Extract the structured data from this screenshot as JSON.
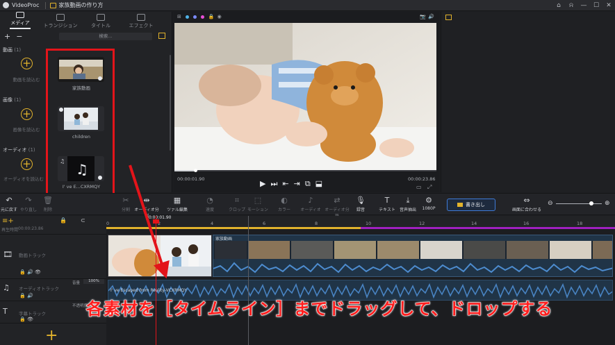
{
  "app": {
    "name": "VideoProc",
    "project_title": "家族動画の作り方"
  },
  "window_controls": [
    "⌂",
    "⍾",
    "—",
    "☐",
    "✕"
  ],
  "left_panel": {
    "tabs": [
      {
        "label": "メディア",
        "active": true
      },
      {
        "label": "トランジション",
        "active": false
      },
      {
        "label": "タイトル",
        "active": false
      },
      {
        "label": "エフェクト",
        "active": false
      }
    ],
    "add_symbol": "+",
    "remove_symbol": "−",
    "search_placeholder": "検索...",
    "sections": [
      {
        "title": "動画",
        "count": "(1)",
        "add_label": "動画を読込む",
        "item_label": "家族動画"
      },
      {
        "title": "画像",
        "count": "(1)",
        "add_label": "画像を読込む",
        "item_label": "children"
      },
      {
        "title": "オーディオ",
        "count": "(1)",
        "add_label": "オーディオを読込む",
        "item_label": "I' ve E...CXRMQY"
      }
    ]
  },
  "preview": {
    "current_time": "00:00:01.90",
    "total_time": "00:00:23.86",
    "toolbar_icons": [
      "grid-icon",
      "color-dots",
      "lock-icon",
      "eye-icon",
      "camera-icon",
      "volume-icon"
    ]
  },
  "edit_toolbar": {
    "tools": [
      {
        "label": "元に戻す",
        "icon": "↶",
        "enabled": true
      },
      {
        "label": "やり直し",
        "icon": "↷",
        "enabled": false
      },
      {
        "label": "削除",
        "icon": "🗑",
        "enabled": false
      },
      {
        "label": "分割",
        "icon": "✂",
        "enabled": false
      },
      {
        "label": "オーディオ分割",
        "icon": "⇹",
        "enabled": true
      },
      {
        "label": "ツァル編集",
        "icon": "▦",
        "enabled": true
      },
      {
        "label": "速度",
        "icon": "◔",
        "enabled": false
      },
      {
        "label": "クロップ",
        "icon": "⌗",
        "enabled": false
      },
      {
        "label": "モーション",
        "icon": "⬚",
        "enabled": false
      },
      {
        "label": "カラー",
        "icon": "◐",
        "enabled": false
      },
      {
        "label": "オーディオ",
        "icon": "♪",
        "enabled": false
      },
      {
        "label": "オーディオ分離",
        "icon": "⇄",
        "enabled": false
      },
      {
        "label": "録音",
        "icon": "🎙",
        "enabled": true
      },
      {
        "label": "テキスト",
        "icon": "T",
        "enabled": true
      },
      {
        "label": "音声抽出",
        "icon": "⤓",
        "enabled": true
      },
      {
        "label": "1080P",
        "icon": "⚙",
        "enabled": true
      }
    ],
    "export_label": "書き出し",
    "fit_label": "画面に合わせる",
    "zoom_minus": "⊖",
    "zoom_plus": "⊕",
    "zoom_level": 0.78
  },
  "timeline": {
    "head_label": "再生時間",
    "timecode": "00:00:23.86",
    "playhead_time": "00:00:01.90",
    "ruler_marks": [
      "0",
      "2",
      "4",
      "6",
      "8",
      "10",
      "12",
      "14",
      "16",
      "18"
    ],
    "tracks": [
      {
        "name": "動画トラック",
        "icon": "🎞"
      },
      {
        "name": "オーディオトラック",
        "icon": "♫",
        "volume_label": "音量",
        "volume": "100%"
      },
      {
        "name": "字幕トラック",
        "icon": "T",
        "extra_label": "不透明度"
      }
    ],
    "video_clip_label": "家族動画",
    "audio_clip_label": "I' ve Escaped from Reality-VCXRMQY"
  },
  "annotation": {
    "caption": "各素材を［タイムライン］までドラッグして、ドロップする",
    "color": "#ff1e1e"
  },
  "colors": {
    "accent": "#e2b32c",
    "highlight": "#e3141a",
    "export_border": "#3f7bd8"
  }
}
